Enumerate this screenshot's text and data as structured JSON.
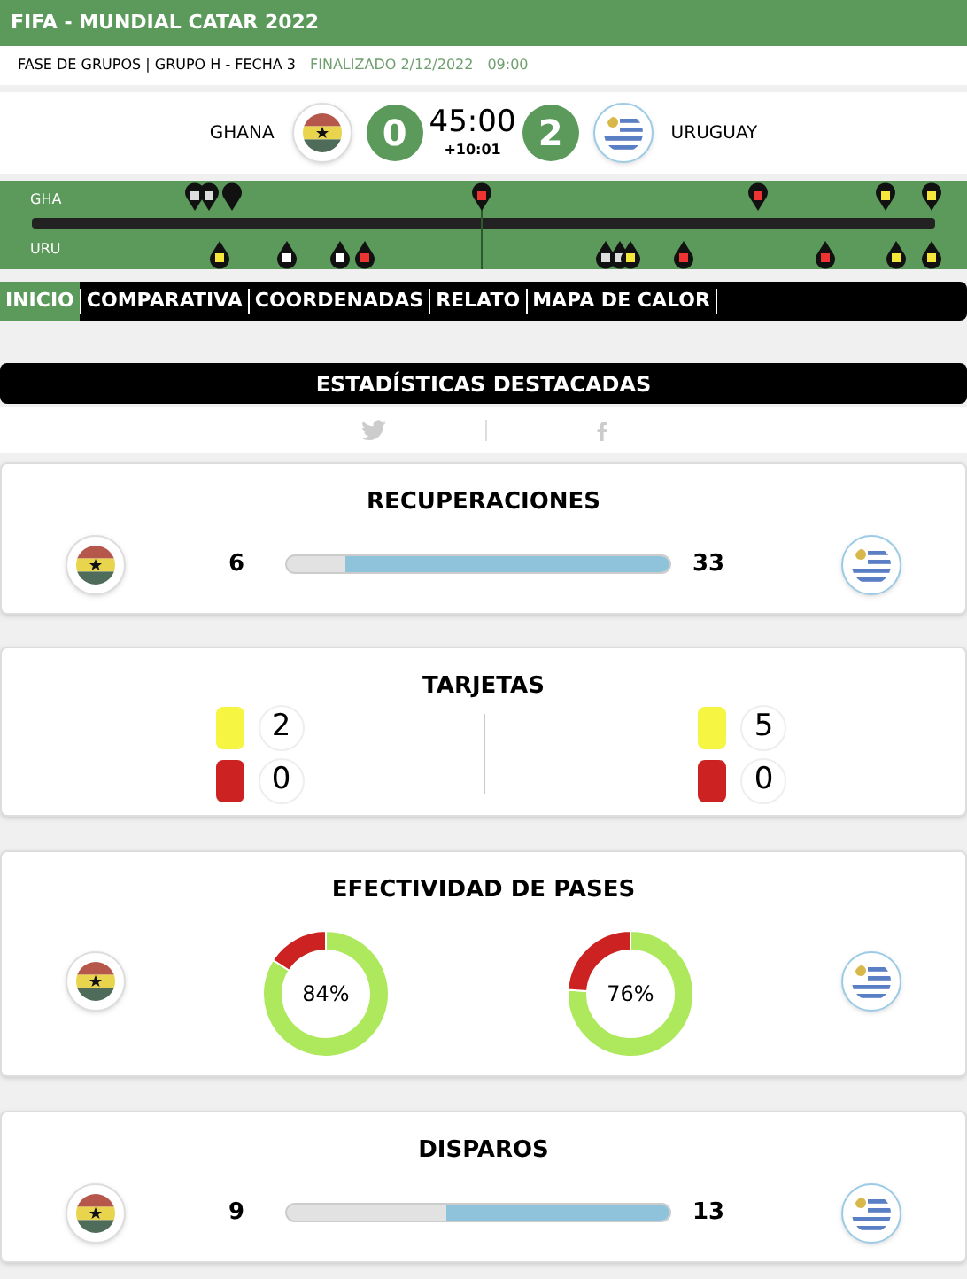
{
  "header": {
    "title": "FIFA - MUNDIAL CATAR 2022"
  },
  "info": {
    "stage": "FASE DE GRUPOS | GRUPO H - FECHA 3",
    "status": "FINALIZADO 2/12/2022",
    "time": "09:00"
  },
  "match": {
    "home": "GHANA",
    "home_score": "0",
    "clock": "45:00",
    "added": "+10:01",
    "away_score": "2",
    "away": "URUGUAY"
  },
  "timeline": {
    "home_label": "GHA",
    "away_label": "URU"
  },
  "tabs": [
    {
      "label": "INICIO",
      "selected": true
    },
    {
      "label": "COMPARATIVA",
      "selected": false
    },
    {
      "label": "COORDENADAS",
      "selected": false
    },
    {
      "label": "RELATO",
      "selected": false
    },
    {
      "label": "MAPA DE CALOR",
      "selected": false
    }
  ],
  "section_title": "ESTADÍSTICAS DESTACADAS",
  "cards": [
    {
      "kind": "bar",
      "title": "RECUPERACIONES",
      "home": "6",
      "away": "33",
      "level": 0.846
    },
    {
      "kind": "cards",
      "title": "TARJETAS",
      "home_yellow": "2",
      "home_red": "0",
      "away_yellow": "5",
      "away_red": "0"
    },
    {
      "kind": "donut",
      "title": "EFECTIVIDAD DE PASES",
      "home": {
        "text": "84%",
        "chart_data": {
          "type": "donut",
          "values": [
            84,
            16
          ]
        }
      },
      "away": {
        "text": "76%",
        "chart_data": {
          "type": "donut",
          "values": [
            76,
            24
          ]
        }
      }
    },
    {
      "kind": "bar",
      "title": "DISPAROS",
      "home": "9",
      "away": "13",
      "level": 0.585
    }
  ]
}
